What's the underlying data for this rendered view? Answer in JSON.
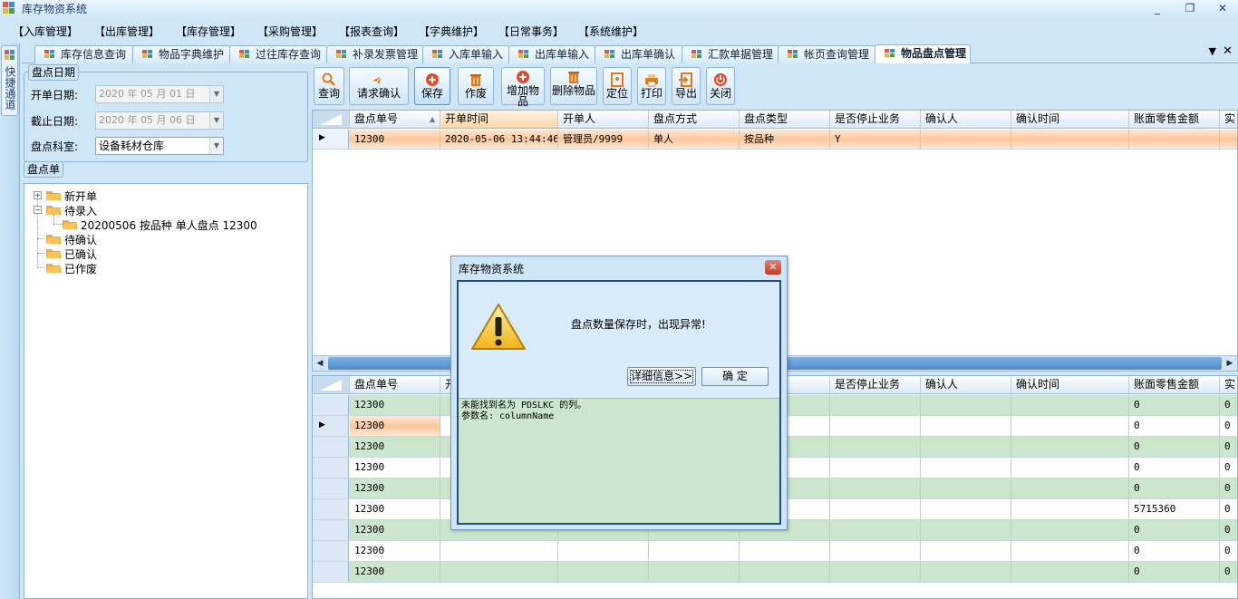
{
  "window": {
    "title": "库存物资系统",
    "controls": [
      "_",
      "❐",
      "✕"
    ]
  },
  "menu": [
    "【入库管理】",
    "【出库管理】",
    "【库存管理】",
    "【采购管理】",
    "【报表查询】",
    "【字典维护】",
    "【日常事务】",
    "【系统维护】"
  ],
  "quickbar": {
    "label": "快捷通道"
  },
  "tabs": [
    "库存信息查询",
    "物品字典维护",
    "过往库存查询",
    "补录发票管理",
    "入库单输入",
    "出库单输入",
    "出库单确认",
    "汇款单据管理",
    "帐页查询管理",
    "物品盘点管理"
  ],
  "active_tab": "物品盘点管理",
  "filters": {
    "legend": "盘点日期",
    "start_label": "开单日期:",
    "start_value": "2020 年 05 月 01 日",
    "end_label": "截止日期:",
    "end_value": "2020 年 05 月 06 日",
    "dept_label": "盘点科室:",
    "dept_value": "设备耗材仓库"
  },
  "tree": {
    "legend": "盘点单",
    "nodes": [
      "新开单",
      "待录入",
      "20200506 按品种 单人盘点 12300",
      "待确认",
      "已确认",
      "已作废"
    ]
  },
  "toolbar": {
    "query": "查询",
    "request_confirm": "请求确认",
    "save": "保存",
    "void": "作废",
    "add_item": "增加物品",
    "delete_item": "删除物品",
    "locate": "定位",
    "print": "打印",
    "export": "导出",
    "close": "关闭"
  },
  "grid_top": {
    "columns": [
      "盘点单号",
      "开单时间",
      "开单人",
      "盘点方式",
      "盘点类型",
      "是否停止业务",
      "确认人",
      "确认时间",
      "账面零售金额",
      "实"
    ],
    "rows": [
      [
        "12300",
        "2020-05-06 13:44:46",
        "管理员/9999",
        "单人",
        "按品种",
        "Y",
        "",
        "",
        "",
        ""
      ]
    ]
  },
  "grid_bottom": {
    "columns": [
      "盘点单号",
      "开",
      "",
      "",
      "",
      "是否停止业务",
      "确认人",
      "确认时间",
      "账面零售金额",
      "实"
    ],
    "rows": [
      [
        "12300",
        "0",
        "0"
      ],
      [
        "12300",
        "0",
        "0"
      ],
      [
        "12300",
        "0",
        "0"
      ],
      [
        "12300",
        "0",
        "0"
      ],
      [
        "12300",
        "0",
        "0"
      ],
      [
        "12300",
        "5715360",
        "0"
      ],
      [
        "12300",
        "0",
        "0"
      ],
      [
        "12300",
        "0",
        "0"
      ],
      [
        "12300",
        "0",
        "0"
      ]
    ]
  },
  "dialog": {
    "title": "库存物资系统",
    "message": "盘点数量保存时，出现异常!",
    "detail_button": "详细信息>>",
    "ok_button": "确    定",
    "detail_text": "未能找到名为 PDSLKC 的列。\n参数名: columnName"
  },
  "colors": {
    "accent": "#cfe6f7",
    "selected_row": "#fbc79a",
    "green_row": "#cce5cd"
  }
}
